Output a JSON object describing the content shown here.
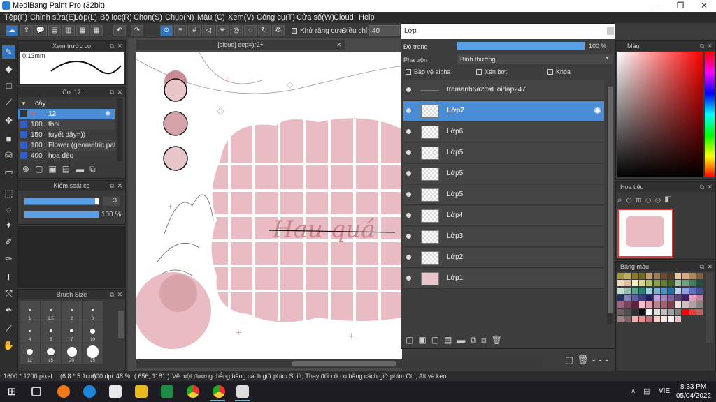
{
  "titlebar": {
    "title": "MediBang Paint Pro (32bit)",
    "min": "─",
    "restore": "❐",
    "close": "✕"
  },
  "menu": [
    "Tệp(F)",
    "Chỉnh sửa(E)",
    "Lớp(L)",
    "Bộ lọc(R)",
    "Chọn(S)",
    "Chụp(N)",
    "Màu (C)",
    "Xem(V)",
    "Công cụ(T)",
    "Cửa số(W)",
    "Cloud",
    "Help"
  ],
  "toolbar": {
    "antialias_label": "Khử răng cưa",
    "adjust_label": "Điều chỉnh",
    "adjust_value": "40"
  },
  "brush_preview": {
    "title": "Xem trước cọ",
    "size": "0.13mm"
  },
  "brush_list": {
    "title": "Cọ: 12",
    "group": "cây",
    "items": [
      {
        "size": "3",
        "name": "12"
      },
      {
        "size": "100",
        "name": "thoi"
      },
      {
        "size": "150",
        "name": "tuyết dây=))"
      },
      {
        "size": "100",
        "name": "Flower (geometric patt"
      },
      {
        "size": "400",
        "name": "hoa đèo"
      }
    ]
  },
  "brush_control": {
    "title": "Kiểm soát cọ",
    "size_value": "3",
    "opacity_value": "100 %",
    "size_fraction": 0.95,
    "opacity_fraction": 1.0
  },
  "brush_size": {
    "title": "Brush Size",
    "labels": [
      "1",
      "1.5",
      "2",
      "3",
      "4",
      "5",
      "7",
      "10",
      "12",
      "15",
      "20",
      "25"
    ]
  },
  "document": {
    "tab": "[cloud] đẹp=)r2+"
  },
  "layers": {
    "title": "Lớp",
    "opacity_label": "Độ trong",
    "opacity_value": "100 %",
    "blend_label": "Pha trộn",
    "blend_value": "Bình thường",
    "protect_alpha": "Bảo vệ alpha",
    "clipping": "Xén bớt",
    "lock": "Khóa",
    "items": [
      {
        "name": "tramanh6a2tt#Hoidap247",
        "selected": false
      },
      {
        "name": "Lớp7",
        "selected": true
      },
      {
        "name": "Lớp6",
        "selected": false
      },
      {
        "name": "Lớp5",
        "selected": false
      },
      {
        "name": "Lớp5",
        "selected": false
      },
      {
        "name": "Lớp5",
        "selected": false
      },
      {
        "name": "Lớp4",
        "selected": false
      },
      {
        "name": "Lớp3",
        "selected": false
      },
      {
        "name": "Lớp2",
        "selected": false
      },
      {
        "name": "Lớp1",
        "selected": false
      }
    ]
  },
  "color_panel": {
    "title": "Màu"
  },
  "navigator": {
    "title": "Hoa tiêu"
  },
  "palette": {
    "title": "Bảng màu",
    "colors": [
      "#a09a30",
      "#c0b050",
      "#8a7a20",
      "#6a6a20",
      "#c0a070",
      "#a07a50",
      "#704a30",
      "#5a3a20",
      "#e8c8a0",
      "#d8a880",
      "#b08860",
      "#806040",
      "#f0d8b8",
      "#e8b898",
      "#f0f0c0",
      "#d8d890",
      "#b0c060",
      "#90a040",
      "#608030",
      "#406020",
      "#a0c0a0",
      "#70a080",
      "#408060",
      "#205040",
      "#c0e0d0",
      "#90c0b0",
      "#60a090",
      "#308070",
      "#a0d0e0",
      "#80b0d0",
      "#5090c0",
      "#2070a0",
      "#c0d0f0",
      "#90a0e0",
      "#6070c0",
      "#405090",
      "#203060",
      "#8080c0",
      "#6060a0",
      "#404080",
      "#202060",
      "#c0a0e0",
      "#a080c0",
      "#8060a0",
      "#604080",
      "#402060",
      "#e0a0c0",
      "#c080a0",
      "#a06080",
      "#804060",
      "#602040",
      "#f0c0d0",
      "#e0a0b0",
      "#c08090",
      "#a06070",
      "#804050",
      "#f0e0e0",
      "#d0c0c0",
      "#b0a0a0",
      "#908080",
      "#706060",
      "#505050",
      "#303030",
      "#101010",
      "#ffffff",
      "#e0e0e0",
      "#c0c0c0",
      "#a0a0a0",
      "#808080",
      "#ff0000",
      "#e04040",
      "#c06060",
      "#a08080",
      "#806060",
      "#f0b0b0",
      "#e09090",
      "#c07070",
      "#ffcccc",
      "#ffe0e0",
      "#fff0f0",
      "#e8c0c8"
    ]
  },
  "status": {
    "size": "1600 * 1200 pixel",
    "physical": "(6.8 * 5.1cm)",
    "dpi": "600 dpi",
    "zoom": "48 %",
    "cursor": "( 656, 1181 )",
    "hint": "Vẽ một đường thẳng bằng cách giữ phím Shift, Thay đổi cỡ cọ bằng cách giữ phím Ctrl, Alt và kéo"
  },
  "taskbar": {
    "lang": "VIE",
    "time": "8:33 PM",
    "date": "05/04/2022"
  }
}
